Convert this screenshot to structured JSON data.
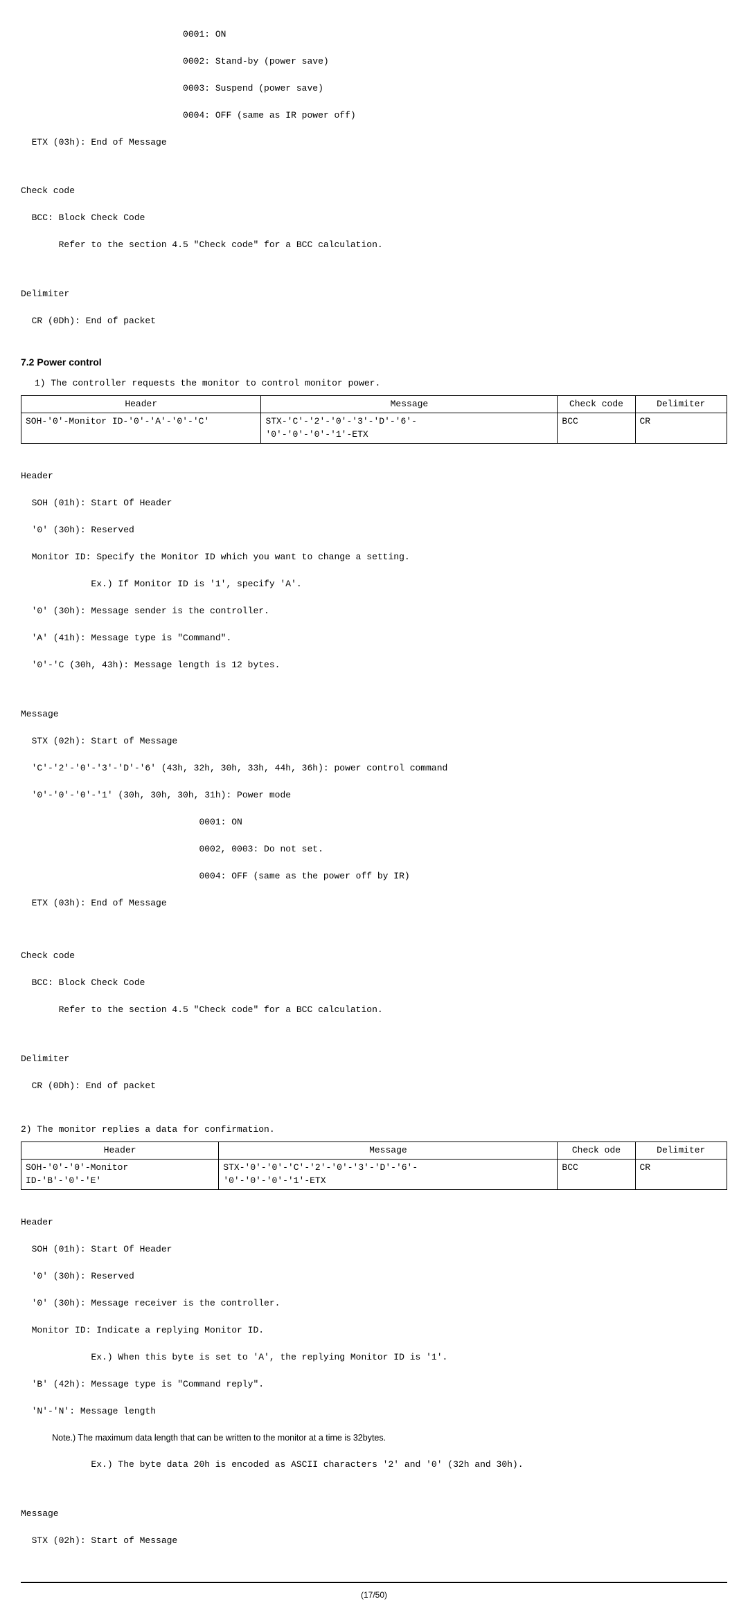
{
  "pre_section": {
    "codes": {
      "l1": "                              0001: ON",
      "l2": "                              0002: Stand-by (power save)",
      "l3": "                              0003: Suspend (power save)",
      "l4": "                              0004: OFF (same as IR power off)"
    },
    "etx": "  ETX (03h): End of Message",
    "check_code_heading": "Check code",
    "bcc": "  BCC: Block Check Code",
    "bcc_ref": "       Refer to the section 4.5 \"Check code\" for a BCC calculation.",
    "delimiter_heading": "Delimiter",
    "cr": "  CR (0Dh): End of packet"
  },
  "section_7_2": {
    "title": "7.2 Power control",
    "intro": "1) The controller requests the monitor to control monitor power.",
    "table1": {
      "headers": {
        "h1": "Header",
        "h2": "Message",
        "h3": "Check code",
        "h4": "Delimiter"
      },
      "row": {
        "c1": "SOH-'0'-Monitor ID-'0'-'A'-'0'-'C'",
        "c2": "STX-'C'-'2'-'0'-'3'-'D'-'6'-\n'0'-'0'-'0'-'1'-ETX",
        "c3": "BCC",
        "c4": "CR"
      }
    },
    "header_block": {
      "heading": "Header",
      "l1": "  SOH (01h): Start Of Header",
      "l2": "  '0' (30h): Reserved",
      "l3": "  Monitor ID: Specify the Monitor ID which you want to change a setting.",
      "l4": "             Ex.) If Monitor ID is '1', specify 'A'.",
      "l5": "  '0' (30h): Message sender is the controller.",
      "l6": "  'A' (41h): Message type is \"Command\".",
      "l7": "  '0'-'C (30h, 43h): Message length is 12 bytes."
    },
    "message_block": {
      "heading": "Message",
      "l1": "  STX (02h): Start of Message",
      "l2": "  'C'-'2'-'0'-'3'-'D'-'6' (43h, 32h, 30h, 33h, 44h, 36h): power control command",
      "l3": "  '0'-'0'-'0'-'1' (30h, 30h, 30h, 31h): Power mode",
      "l4": "                                 0001: ON",
      "l5": "                                 0002, 0003: Do not set.",
      "l6": "                                 0004: OFF (same as the power off by IR)",
      "l7": "  ETX (03h): End of Message"
    },
    "check_code_block": {
      "heading": "Check code",
      "l1": "  BCC: Block Check Code",
      "l2": "       Refer to the section 4.5 \"Check code\" for a BCC calculation."
    },
    "delimiter_block": {
      "heading": "Delimiter",
      "l1": "  CR (0Dh): End of packet"
    },
    "reply_intro": "2) The monitor replies a data for confirmation.",
    "table2": {
      "headers": {
        "h1": "Header",
        "h2": "Message",
        "h3": "Check ode",
        "h4": "Delimiter"
      },
      "row": {
        "c1": "SOH-'0'-'0'-Monitor\nID-'B'-'0'-'E'",
        "c2": "STX-'0'-'0'-'C'-'2'-'0'-'3'-'D'-'6'-\n'0'-'0'-'0'-'1'-ETX",
        "c3": "BCC",
        "c4": "CR"
      }
    },
    "header_block2": {
      "heading": "Header",
      "l1": "  SOH (01h): Start Of Header",
      "l2": "  '0' (30h): Reserved",
      "l3": "  '0' (30h): Message receiver is the controller.",
      "l4": "  Monitor ID: Indicate a replying Monitor ID.",
      "l5": "             Ex.) When this byte is set to 'A', the replying Monitor ID is '1'.",
      "l6": "  'B' (42h): Message type is \"Command reply\".",
      "l7": "  'N'-'N': Message length",
      "l8": "             Note.) The maximum data length that can be written to the monitor at a time is 32bytes.",
      "l9": "             Ex.) The byte data 20h is encoded as ASCII characters '2' and '0' (32h and 30h)."
    },
    "message_block2": {
      "heading": "Message",
      "l1": "  STX (02h): Start of Message"
    }
  },
  "footer": "(17/50)"
}
